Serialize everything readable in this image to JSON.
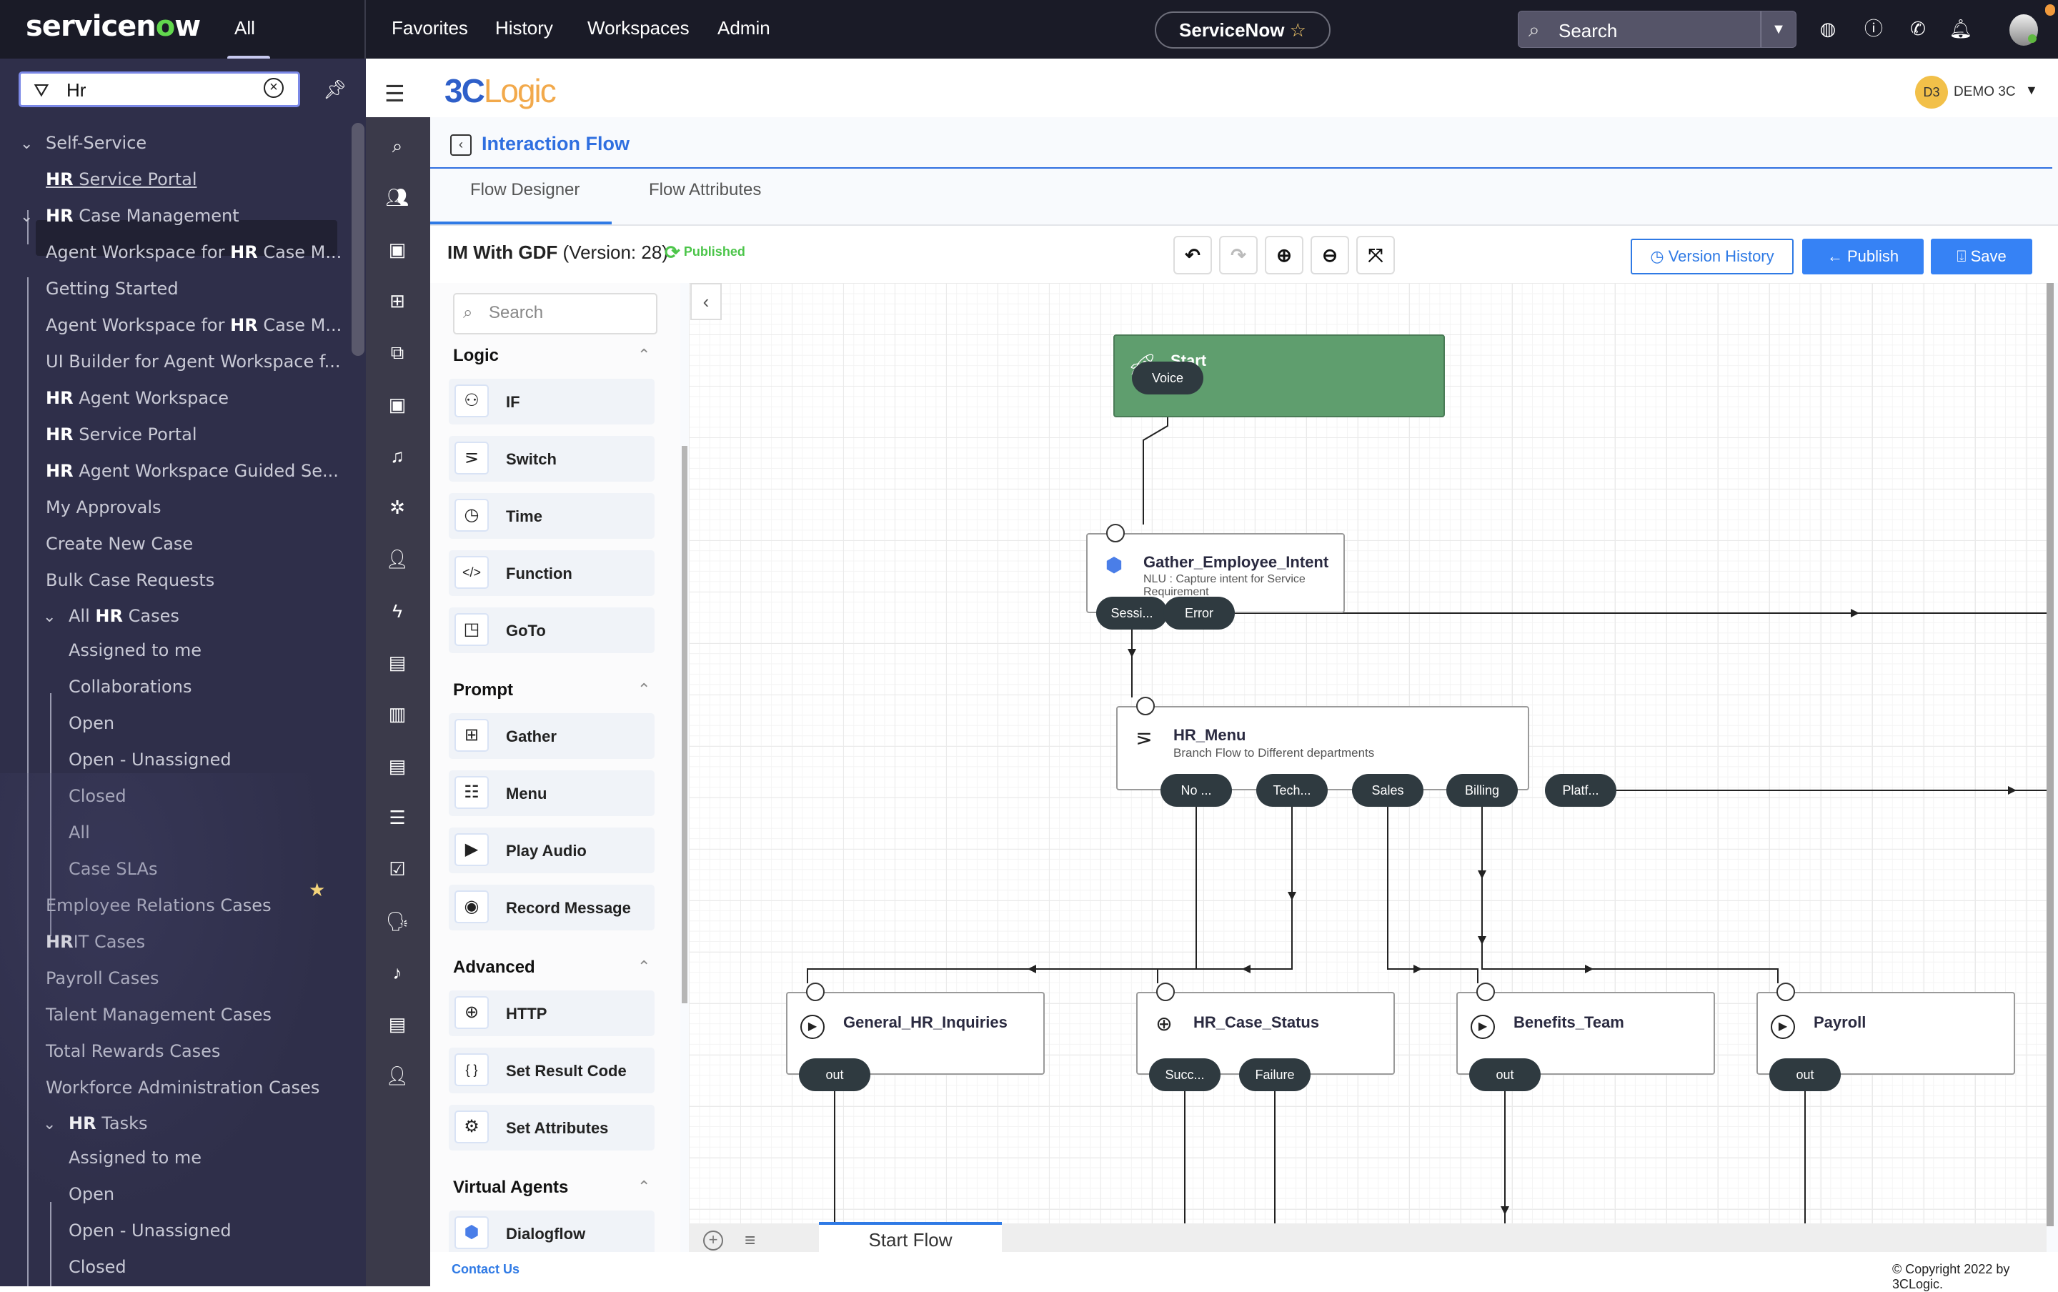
{
  "topbar": {
    "brand": "servicenow",
    "all_tab": "All",
    "nav": [
      "Favorites",
      "History",
      "Workspaces",
      "Admin"
    ],
    "instance_pill": "ServiceNow",
    "search_placeholder": "Search",
    "icons": [
      "globe-icon",
      "help-icon",
      "phone-icon",
      "bell-icon"
    ]
  },
  "leftnav": {
    "filter_value": "Hr",
    "items": [
      {
        "pre": "",
        "bold": "",
        "text": "Self-Service",
        "level": 0,
        "expandable": true
      },
      {
        "pre": "",
        "bold": "HR",
        "text": " Service Portal",
        "level": 1,
        "selected": true
      },
      {
        "pre": "",
        "bold": "HR",
        "text": " Case Management",
        "level": 0,
        "expandable": true
      },
      {
        "pre": "Agent Workspace for ",
        "bold": "HR",
        "text": " Case M...",
        "level": 1
      },
      {
        "pre": "",
        "bold": "",
        "text": "Getting Started",
        "level": 1
      },
      {
        "pre": "Agent Workspace for ",
        "bold": "HR",
        "text": " Case M...",
        "level": 1
      },
      {
        "pre": "",
        "bold": "",
        "text": "UI Builder for Agent Workspace f...",
        "level": 1
      },
      {
        "pre": "",
        "bold": "HR",
        "text": " Agent Workspace",
        "level": 1
      },
      {
        "pre": "",
        "bold": "HR",
        "text": " Service Portal",
        "level": 1
      },
      {
        "pre": "",
        "bold": "HR",
        "text": " Agent Workspace Guided Se...",
        "level": 1
      },
      {
        "pre": "",
        "bold": "",
        "text": "My Approvals",
        "level": 1
      },
      {
        "pre": "",
        "bold": "",
        "text": "Create New Case",
        "level": 1
      },
      {
        "pre": "",
        "bold": "",
        "text": "Bulk Case Requests",
        "level": 1
      },
      {
        "pre": "All ",
        "bold": "HR",
        "text": " Cases",
        "level": 1,
        "expandable": true
      },
      {
        "pre": "",
        "bold": "",
        "text": "Assigned to me",
        "level": 2
      },
      {
        "pre": "",
        "bold": "",
        "text": "Collaborations",
        "level": 2
      },
      {
        "pre": "",
        "bold": "",
        "text": "Open",
        "level": 2
      },
      {
        "pre": "",
        "bold": "",
        "text": "Open - Unassigned",
        "level": 2
      },
      {
        "pre": "",
        "bold": "",
        "text": "Closed",
        "level": 2
      },
      {
        "pre": "",
        "bold": "",
        "text": "All",
        "level": 2,
        "favorite": true
      },
      {
        "pre": "",
        "bold": "",
        "text": "Case SLAs",
        "level": 2
      },
      {
        "pre": "",
        "bold": "",
        "text": "Employee Relations Cases",
        "level": 1
      },
      {
        "pre": "",
        "bold": "HR",
        "text": "IT Cases",
        "level": 1
      },
      {
        "pre": "",
        "bold": "",
        "text": "Payroll Cases",
        "level": 1
      },
      {
        "pre": "",
        "bold": "",
        "text": "Talent Management Cases",
        "level": 1
      },
      {
        "pre": "",
        "bold": "",
        "text": "Total Rewards Cases",
        "level": 1
      },
      {
        "pre": "",
        "bold": "",
        "text": "Workforce Administration Cases",
        "level": 1
      },
      {
        "pre": "",
        "bold": "HR",
        "text": " Tasks",
        "level": 1,
        "expandable": true
      },
      {
        "pre": "",
        "bold": "",
        "text": "Assigned to me",
        "level": 2
      },
      {
        "pre": "",
        "bold": "",
        "text": "Open",
        "level": 2
      },
      {
        "pre": "",
        "bold": "",
        "text": "Open - Unassigned",
        "level": 2
      },
      {
        "pre": "",
        "bold": "",
        "text": "Closed",
        "level": 2
      }
    ]
  },
  "app": {
    "logo_a": "3C",
    "logo_b": "Logic",
    "user_initials": "D3",
    "user_name": "DEMO 3C",
    "page_title": "Interaction Flow",
    "tabs": [
      "Flow Designer",
      "Flow Attributes"
    ],
    "active_tab": "Flow Designer",
    "flow_name": "IM With GDF",
    "flow_version": "(Version: 28)",
    "status": "Published",
    "buttons": {
      "version_history": "Version History",
      "publish": "Publish",
      "save": "Save"
    },
    "contact": "Contact Us",
    "copyright": "© Copyright 2022 by 3CLogic."
  },
  "palette": {
    "search_placeholder": "Search",
    "sections": [
      {
        "title": "Logic",
        "items": [
          {
            "label": "IF",
            "icon": "if-branch-icon"
          },
          {
            "label": "Switch",
            "icon": "switch-icon"
          },
          {
            "label": "Time",
            "icon": "clock-icon"
          },
          {
            "label": "Function",
            "icon": "code-icon"
          },
          {
            "label": "GoTo",
            "icon": "goto-icon"
          }
        ]
      },
      {
        "title": "Prompt",
        "items": [
          {
            "label": "Gather",
            "icon": "gather-icon"
          },
          {
            "label": "Menu",
            "icon": "menu-list-icon"
          },
          {
            "label": "Play Audio",
            "icon": "play-icon"
          },
          {
            "label": "Record Message",
            "icon": "record-icon"
          }
        ]
      },
      {
        "title": "Advanced",
        "items": [
          {
            "label": "HTTP",
            "icon": "globe-icon"
          },
          {
            "label": "Set Result Code",
            "icon": "braces-icon"
          },
          {
            "label": "Set Attributes",
            "icon": "settings-icon"
          }
        ]
      },
      {
        "title": "Virtual Agents",
        "items": [
          {
            "label": "Dialogflow",
            "icon": "dialogflow-icon"
          }
        ]
      }
    ]
  },
  "flow": {
    "start": {
      "title": "Start",
      "ports": [
        "Voice"
      ]
    },
    "nodes": [
      {
        "id": "gather",
        "title": "Gather_Employee_Intent",
        "subtitle": "NLU : Capture intent for Service Requirement",
        "icon": "dialogflow-icon",
        "ports": [
          "Sessi...",
          "Error"
        ]
      },
      {
        "id": "menu",
        "title": "HR_Menu",
        "subtitle": "Branch Flow to Different departments",
        "icon": "switch-icon",
        "ports": [
          "No ...",
          "Tech...",
          "Sales",
          "Billing",
          "Platf..."
        ]
      },
      {
        "id": "general",
        "title": "General_HR_Inquiries",
        "subtitle": "",
        "icon": "play-icon",
        "ports": [
          "out"
        ]
      },
      {
        "id": "status",
        "title": "HR_Case_Status",
        "subtitle": "",
        "icon": "globe-icon",
        "ports": [
          "Succ...",
          "Failure"
        ]
      },
      {
        "id": "benefits",
        "title": "Benefits_Team",
        "subtitle": "",
        "icon": "play-icon",
        "ports": [
          "out"
        ]
      },
      {
        "id": "payroll",
        "title": "Payroll",
        "subtitle": "",
        "icon": "play-icon",
        "ports": [
          "out"
        ]
      }
    ],
    "flow_tabs": [
      "Start Flow"
    ]
  }
}
